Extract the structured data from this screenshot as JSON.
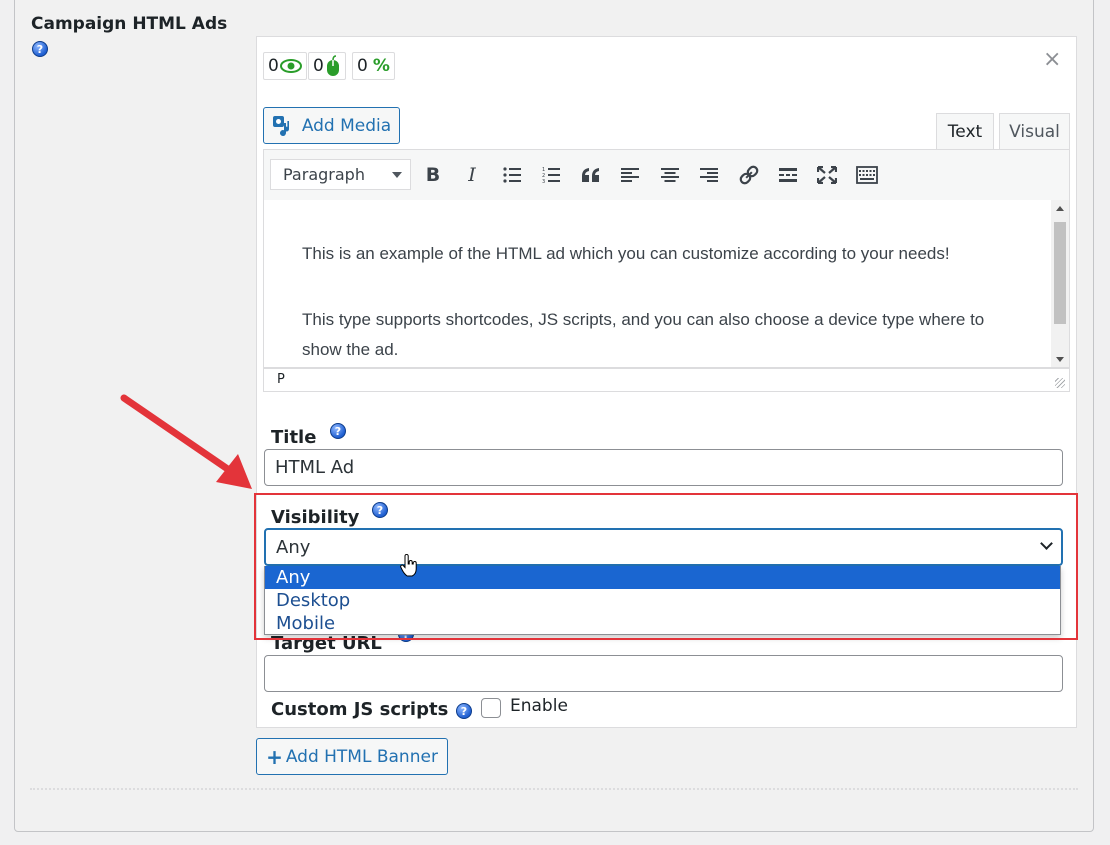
{
  "section": {
    "title": "Campaign HTML Ads",
    "help": "?"
  },
  "stats": [
    {
      "value": "0",
      "icon": "eye-icon",
      "color": "#2a9d2a"
    },
    {
      "value": "0",
      "icon": "mouse-icon",
      "color": "#2a9d2a"
    },
    {
      "value": "0",
      "icon": "percent-icon",
      "glyph": "%",
      "color": "#2a9d2a"
    }
  ],
  "close_glyph": "×",
  "media_button": {
    "label": "Add Media",
    "icon": "media-icon"
  },
  "tabs": {
    "text": "Text",
    "visual": "Visual"
  },
  "toolbar": {
    "format_select": "Paragraph",
    "buttons": [
      "bold-icon",
      "italic-icon",
      "bullet-list-icon",
      "numbered-list-icon",
      "blockquote-icon",
      "align-left-icon",
      "align-center-icon",
      "align-right-icon",
      "link-icon",
      "read-more-icon",
      "fullscreen-icon",
      "toolbar-toggle-icon"
    ]
  },
  "editor": {
    "paragraph1": "This is an example of the HTML ad which you can customize according to your needs!",
    "paragraph2": "This type supports shortcodes, JS scripts, and you can also choose a device type where to show the ad.",
    "status_path": "P"
  },
  "fields": {
    "title_label": "Title",
    "title_value": "HTML Ad",
    "visibility_label": "Visibility",
    "visibility_value": "Any",
    "visibility_options": [
      "Any",
      "Desktop",
      "Mobile"
    ],
    "target_url_label": "Target URL",
    "target_url_value": "",
    "custom_js_label": "Custom JS scripts",
    "custom_js_checkbox": "Enable",
    "custom_js_checked": false
  },
  "add_banner_button": {
    "glyph": "+",
    "label": "Add HTML Banner"
  },
  "colors": {
    "accent": "#2271b1",
    "highlight": "#e3343a",
    "selected_option": "#1a66d1"
  }
}
